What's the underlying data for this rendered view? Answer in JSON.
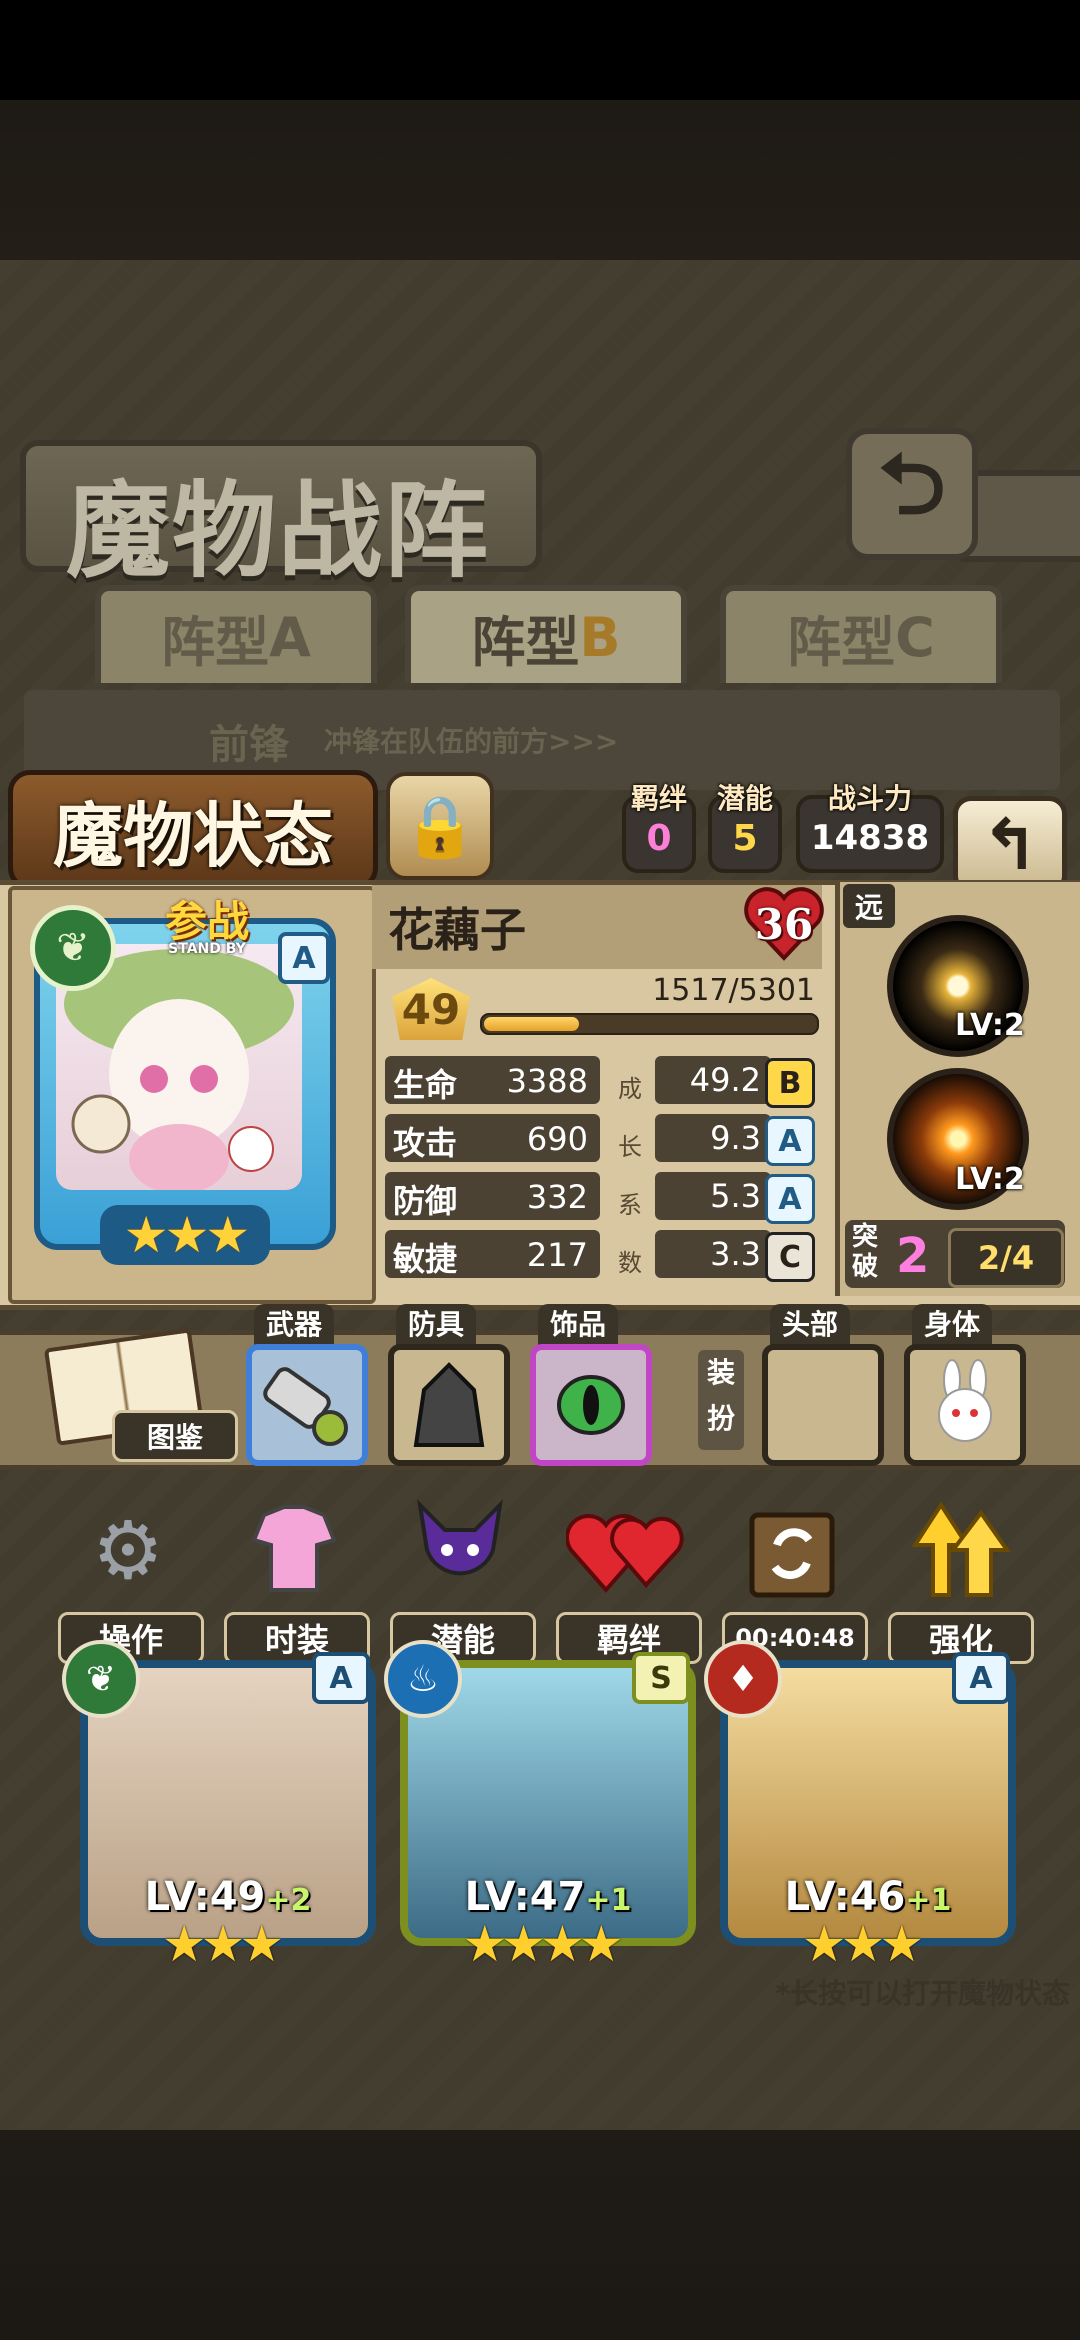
{
  "screen_title": "魔物战阵",
  "formation_tabs": [
    {
      "label": "阵型",
      "letter": "A",
      "active": false
    },
    {
      "label": "阵型",
      "letter": "B",
      "active": true
    },
    {
      "label": "阵型",
      "letter": "C",
      "active": false
    }
  ],
  "vanguard": {
    "label": "前锋",
    "desc": "冲锋在队伍的前方>>>"
  },
  "status_panel": {
    "title": "魔物状态",
    "bond": {
      "label": "羁绊",
      "value": "0"
    },
    "potential": {
      "label": "潜能",
      "value": "5"
    },
    "power": {
      "label": "战斗力",
      "value": "14838"
    }
  },
  "monster": {
    "standby_label": "参战",
    "standby_sub": "STAND BY",
    "rank": "A",
    "stars": "★★★",
    "name": "花藕子",
    "heart_value": "36",
    "level": "49",
    "exp_text": "1517/5301",
    "exp_fraction": 0.286,
    "growth_label": [
      "成",
      "长",
      "系",
      "数"
    ],
    "stats": [
      {
        "name": "生命",
        "value": "3388",
        "growth": "49.2",
        "grade": "B"
      },
      {
        "name": "攻击",
        "value": "690",
        "growth": "9.3",
        "grade": "A"
      },
      {
        "name": "防御",
        "value": "332",
        "growth": "5.3",
        "grade": "A"
      },
      {
        "name": "敏捷",
        "value": "217",
        "growth": "3.3",
        "grade": "C"
      }
    ],
    "range_tag": "远",
    "skills": [
      {
        "lv": "LV:2",
        "icon": "burst-skill-icon"
      },
      {
        "lv": "LV:2",
        "icon": "explosion-skill-icon"
      }
    ],
    "breakthrough": {
      "label": "突破",
      "value": "2",
      "progress": "2/4"
    }
  },
  "equipment": {
    "codex_label": "图鉴",
    "slots": [
      {
        "label": "武器",
        "icon": "weapon-gatling-icon",
        "border": "#3f7fd9"
      },
      {
        "label": "防具",
        "icon": "cloak-icon",
        "border": "#2e271c"
      },
      {
        "label": "饰品",
        "icon": "eye-amulet-icon",
        "border": "#c146c6"
      }
    ],
    "dress_label": "装扮",
    "dress_slots": [
      {
        "label": "头部",
        "icon": ""
      },
      {
        "label": "身体",
        "icon": "bunny-icon"
      }
    ]
  },
  "actions": [
    {
      "label": "操作",
      "icon": "gear-icon"
    },
    {
      "label": "时装",
      "icon": "outfit-icon"
    },
    {
      "label": "潜能",
      "icon": "demon-icon"
    },
    {
      "label": "羁绊",
      "icon": "hearts-icon"
    },
    {
      "label": "00:40:48",
      "icon": "refresh-chest-icon"
    },
    {
      "label": "强化",
      "icon": "upgrade-arrows-icon"
    }
  ],
  "team_cards": [
    {
      "lv": "LV:49",
      "plus": "+2",
      "rank": "A",
      "stars": "★★★",
      "element": "leaf"
    },
    {
      "lv": "LV:47",
      "plus": "+1",
      "rank": "S",
      "stars": "★★★★",
      "element": "water"
    },
    {
      "lv": "LV:46",
      "plus": "+1",
      "rank": "A",
      "stars": "★★★",
      "element": "fire"
    }
  ],
  "hint_text": "*长按可以打开魔物状态"
}
